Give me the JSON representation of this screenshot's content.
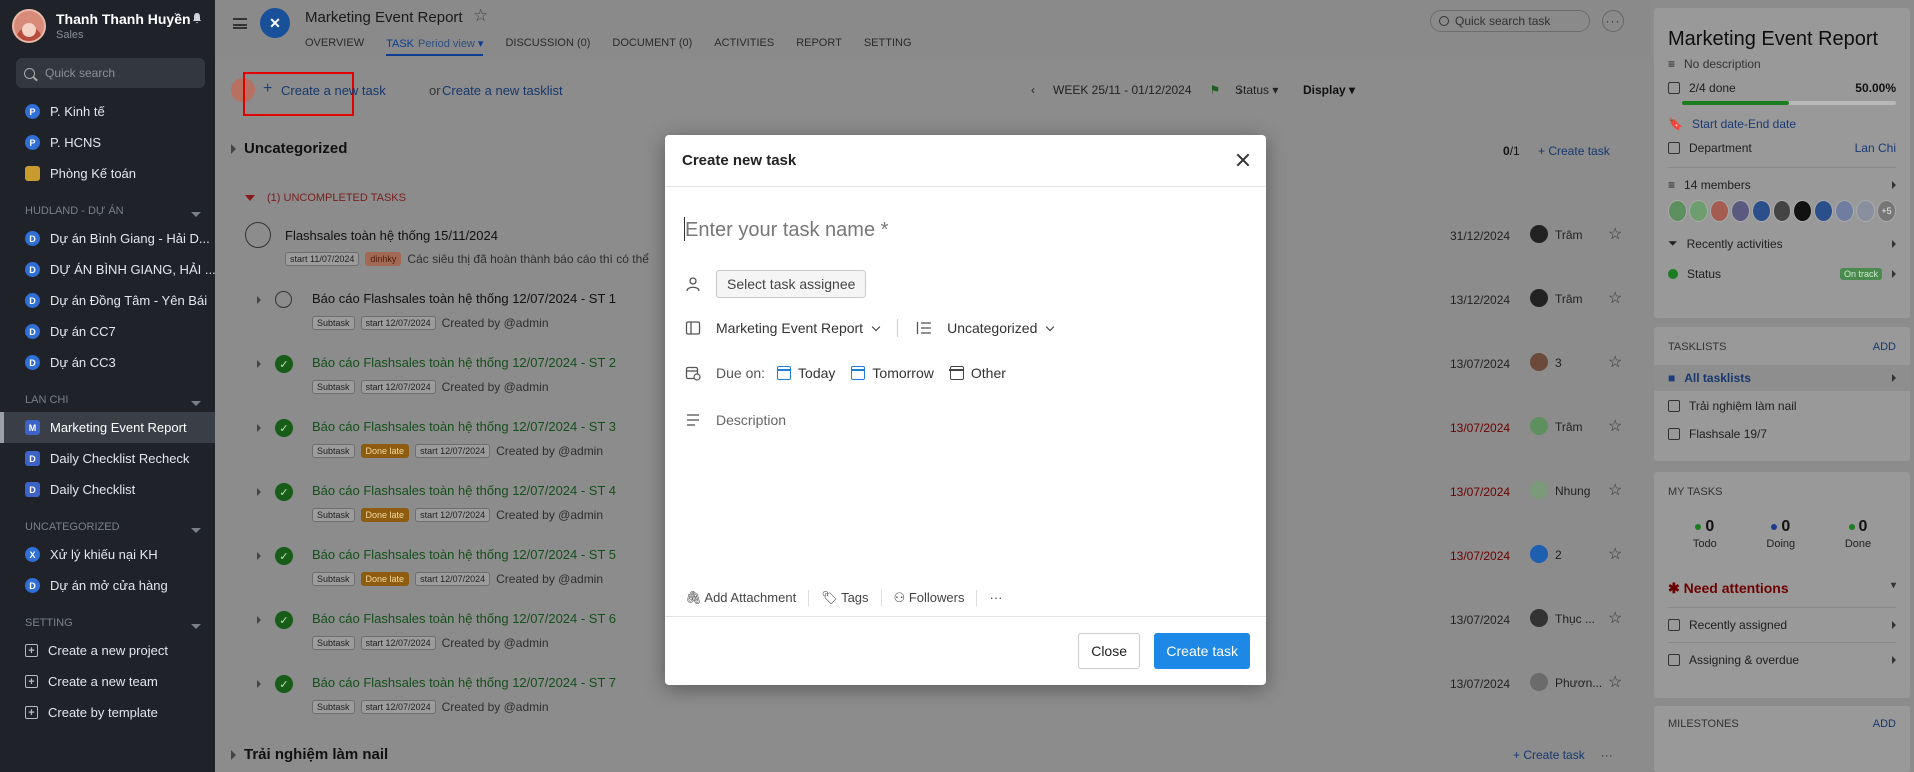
{
  "user": {
    "name": "Thanh Thanh Huyền",
    "role": "Sales"
  },
  "sidebar": {
    "search_placeholder": "Quick search",
    "top_items": [
      {
        "badge": "P",
        "label": "P. Kinh tế"
      },
      {
        "badge": "P",
        "label": "P. HCNS"
      },
      {
        "badge": "",
        "label": "Phòng Kế toán"
      }
    ],
    "sections": [
      {
        "title": "HUDLAND - DỰ ÁN",
        "items": [
          {
            "badge": "D",
            "label": "Dự án Bình Giang - Hải D..."
          },
          {
            "badge": "D",
            "label": "DỰ ÁN BÌNH GIANG, HẢI ..."
          },
          {
            "badge": "D",
            "label": "Dự án Đồng Tâm - Yên Bái"
          },
          {
            "badge": "D",
            "label": "Dự án CC7"
          },
          {
            "badge": "D",
            "label": "Dự án CC3"
          }
        ]
      },
      {
        "title": "LAN CHI",
        "items": [
          {
            "badge": "M",
            "label": "Marketing Event Report"
          },
          {
            "badge": "D",
            "label": "Daily Checklist Recheck"
          },
          {
            "badge": "D",
            "label": "Daily Checklist"
          }
        ]
      },
      {
        "title": "UNCATEGORIZED",
        "items": [
          {
            "badge": "X",
            "label": "Xử lý khiếu nại KH"
          },
          {
            "badge": "D",
            "label": "Dự án mở cửa hàng"
          }
        ]
      },
      {
        "title": "SETTING",
        "items": [
          {
            "badge": "+",
            "label": "Create a new project"
          },
          {
            "badge": "+",
            "label": "Create a new team"
          },
          {
            "badge": "+",
            "label": "Create by template"
          }
        ]
      }
    ]
  },
  "header": {
    "logo": "✕",
    "title": "Marketing Event Report",
    "tabs": [
      "OVERVIEW",
      "TASK",
      "DISCUSSION (0)",
      "DOCUMENT (0)",
      "ACTIVITIES",
      "REPORT",
      "SETTING"
    ],
    "task_sub": "Period view",
    "quick_search": "Quick search task"
  },
  "toolbar": {
    "create_task": "Create a new task",
    "or": "or",
    "create_tasklist": "Create a new tasklist",
    "week": "WEEK 25/11 - 01/12/2024",
    "status": "Status",
    "display": "Display"
  },
  "group": {
    "title": "Uncategorized",
    "count_done": "0",
    "count_total": "/1",
    "create": "Create task",
    "uncompleted": "(1) UNCOMPLETED TASKS"
  },
  "tasks": [
    {
      "name": "Flashsales toàn hệ thống 15/11/2024",
      "chips": [
        "start 11/07/2024",
        "dinhky"
      ],
      "note": "Các siêu thị đã hoàn thành báo cáo thì có thể",
      "date": "31/12/2024",
      "assignee": "Trâm",
      "done": false,
      "parent": true,
      "red": false
    },
    {
      "name": "Báo cáo Flashsales toàn hệ thống 12/07/2024 - ST 1",
      "chips": [
        "Subtask",
        "start 12/07/2024"
      ],
      "note": "Created by @admin",
      "date": "13/12/2024",
      "assignee": "Trâm",
      "done": false,
      "red": false
    },
    {
      "name": "Báo cáo Flashsales toàn hệ thống 12/07/2024 - ST 2",
      "chips": [
        "Subtask",
        "start 12/07/2024"
      ],
      "note": "Created by @admin",
      "date": "13/07/2024",
      "assignee": "3",
      "done": true,
      "red": false
    },
    {
      "name": "Báo cáo Flashsales toàn hệ thống 12/07/2024 - ST 3",
      "chips": [
        "Subtask",
        "Done late",
        "start 12/07/2024"
      ],
      "note": "Created by @admin",
      "date": "13/07/2024",
      "assignee": "Trâm",
      "done": true,
      "red": true
    },
    {
      "name": "Báo cáo Flashsales toàn hệ thống 12/07/2024 - ST 4",
      "chips": [
        "Subtask",
        "Done late",
        "start 12/07/2024"
      ],
      "note": "Created by @admin",
      "date": "13/07/2024",
      "assignee": "Nhung",
      "done": true,
      "red": true
    },
    {
      "name": "Báo cáo Flashsales toàn hệ thống 12/07/2024 - ST 5",
      "chips": [
        "Subtask",
        "Done late",
        "start 12/07/2024"
      ],
      "note": "Created by @admin",
      "date": "13/07/2024",
      "assignee": "2",
      "done": true,
      "red": true
    },
    {
      "name": "Báo cáo Flashsales toàn hệ thống 12/07/2024 - ST 6",
      "chips": [
        "Subtask",
        "start 12/07/2024"
      ],
      "note": "Created by @admin",
      "date": "13/07/2024",
      "assignee": "Thục ...",
      "done": true,
      "red": false
    },
    {
      "name": "Báo cáo Flashsales toàn hệ thống 12/07/2024 - ST 7",
      "chips": [
        "Subtask",
        "start 12/07/2024"
      ],
      "note": "Created by @admin",
      "date": "13/07/2024",
      "assignee": "Phươn...",
      "done": true,
      "red": false
    }
  ],
  "next_group": {
    "title": "Trải nghiệm làm nail",
    "create": "Create task"
  },
  "right": {
    "title": "Marketing Event Report",
    "description": "No description",
    "done": "2/4 done",
    "percent_label": "50.00%",
    "progress": 0.5,
    "start": "Start date",
    "dash": " - ",
    "end": "End date",
    "department": "Department",
    "department_value": "Lan Chi",
    "members": "14 members",
    "members_more": "+5",
    "recent": "Recently activities",
    "status": "Status",
    "status_value": "On track",
    "tasklists_title": "TASKLISTS",
    "add": "ADD",
    "tasklists": [
      "All tasklists",
      "Trải nghiệm làm nail",
      "Flashsale 19/7"
    ],
    "my_tasks_title": "MY TASKS",
    "my_tasks": [
      {
        "num": "0",
        "label": "Todo",
        "color": "#1a7d1f"
      },
      {
        "num": "0",
        "label": "Doing",
        "color": "#1e3a8a"
      },
      {
        "num": "0",
        "label": "Done",
        "color": "#1a7d1f"
      }
    ],
    "need_attention": "Need attentions",
    "recently_assigned": "Recently assigned",
    "assigning_overdue": "Assigning & overdue",
    "milestones": "MILESTONES"
  },
  "modal": {
    "title": "Create new task",
    "name_placeholder": "Enter your task name *",
    "assignee_placeholder": "Select task assignee",
    "project": "Marketing Event Report",
    "tasklist": "Uncategorized",
    "due_label": "Due on:",
    "today": "Today",
    "tomorrow": "Tomorrow",
    "other": "Other",
    "description_placeholder": "Description",
    "attachment": "Add Attachment",
    "tags": "Tags",
    "followers": "Followers",
    "more": "···",
    "close": "Close",
    "create": "Create task"
  }
}
